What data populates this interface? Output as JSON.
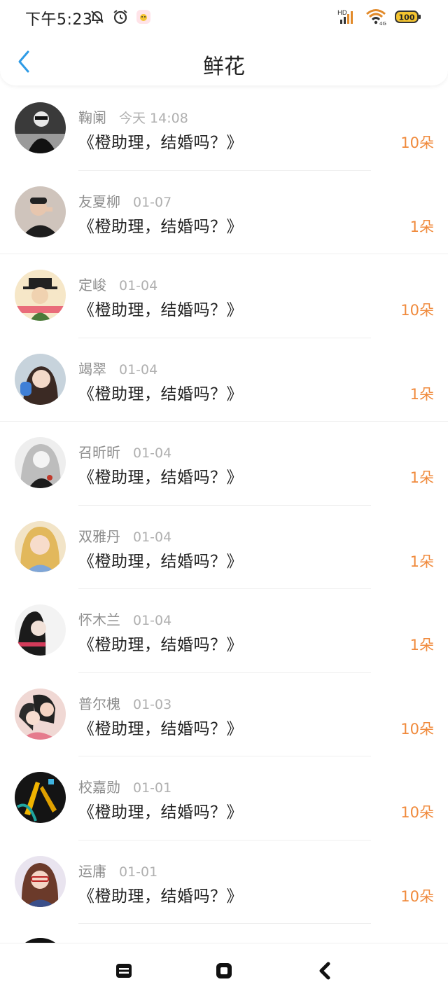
{
  "status_bar": {
    "time": "下午5:23",
    "hd_label": "HD",
    "network_label": "4G",
    "battery": "100"
  },
  "header": {
    "title": "鲜花"
  },
  "colors": {
    "accent": "#2e9be6",
    "count": "#f08a3c"
  },
  "items": [
    {
      "name": "鞠阑",
      "date": "今天 14:08",
      "book": "《橙助理，结婚吗？》",
      "count": "10朵"
    },
    {
      "name": "友夏柳",
      "date": "01-07",
      "book": "《橙助理，结婚吗？》",
      "count": "1朵"
    },
    {
      "name": "定峻",
      "date": "01-04",
      "book": "《橙助理，结婚吗？》",
      "count": "10朵"
    },
    {
      "name": "竭翠",
      "date": "01-04",
      "book": "《橙助理，结婚吗？》",
      "count": "1朵"
    },
    {
      "name": "召昕昕",
      "date": "01-04",
      "book": "《橙助理，结婚吗？》",
      "count": "1朵"
    },
    {
      "name": "双雅丹",
      "date": "01-04",
      "book": "《橙助理，结婚吗？》",
      "count": "1朵"
    },
    {
      "name": "怀木兰",
      "date": "01-04",
      "book": "《橙助理，结婚吗？》",
      "count": "1朵"
    },
    {
      "name": "普尔槐",
      "date": "01-03",
      "book": "《橙助理，结婚吗？》",
      "count": "10朵"
    },
    {
      "name": "校嘉勋",
      "date": "01-01",
      "book": "《橙助理，结婚吗？》",
      "count": "10朵"
    },
    {
      "name": "运庸",
      "date": "01-01",
      "book": "《橙助理，结婚吗？》",
      "count": "10朵"
    }
  ]
}
